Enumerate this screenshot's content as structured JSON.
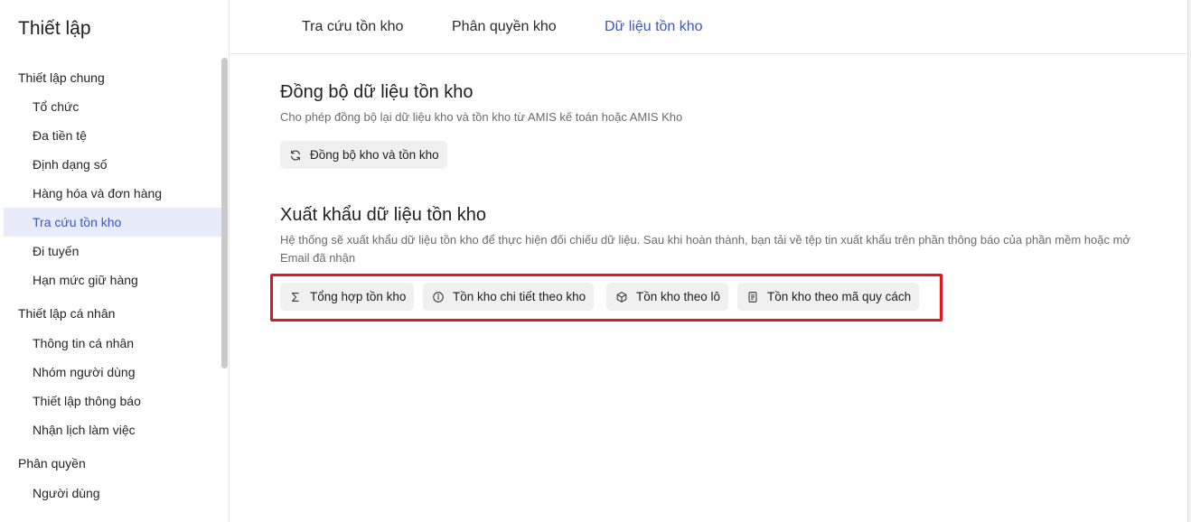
{
  "sidebar": {
    "title": "Thiết lập",
    "groups": [
      {
        "label": "Thiết lập chung",
        "items": [
          "Tổ chức",
          "Đa tiền tệ",
          "Định dạng số",
          "Hàng hóa và đơn hàng",
          "Tra cứu tồn kho",
          "Đi tuyến",
          "Hạn mức giữ hàng"
        ]
      },
      {
        "label": "Thiết lập cá nhân",
        "items": [
          "Thông tin cá nhân",
          "Nhóm người dùng",
          "Thiết lập thông báo",
          "Nhận lịch làm việc"
        ]
      },
      {
        "label": "Phân quyền",
        "items": [
          "Người dùng"
        ]
      }
    ],
    "active_item": "Tra cứu tồn kho"
  },
  "tabs": [
    "Tra cứu tồn kho",
    "Phân quyền kho",
    "Dữ liệu tồn kho"
  ],
  "active_tab": "Dữ liệu tồn kho",
  "sync_section": {
    "title": "Đồng bộ dữ liệu tồn kho",
    "description": "Cho phép đồng bộ lại dữ liệu kho và tồn kho từ AMIS kế toán hoặc AMIS Kho",
    "button": {
      "label": "Đồng bộ kho và tồn kho",
      "icon": "refresh-icon"
    }
  },
  "export_section": {
    "title": "Xuất khẩu dữ liệu tồn kho",
    "description": "Hệ thống sẽ xuất khẩu dữ liệu tồn kho để thực hiện đối chiếu dữ liệu. Sau khi hoàn thành, bạn tải về tệp tin xuất khẩu trên phần thông báo của phần mềm hoặc mở Email đã nhận",
    "buttons": [
      {
        "label": "Tổng hợp tồn kho",
        "icon": "sigma-icon"
      },
      {
        "label": "Tồn kho chi tiết theo kho",
        "icon": "info-circle-icon"
      },
      {
        "label": "Tồn kho theo lô",
        "icon": "box-icon"
      },
      {
        "label": "Tồn kho theo mã quy cách",
        "icon": "document-icon"
      }
    ]
  },
  "colors": {
    "accent": "#3a57c4",
    "highlight": "#e3161b",
    "button_bg": "#f0f0f0"
  }
}
